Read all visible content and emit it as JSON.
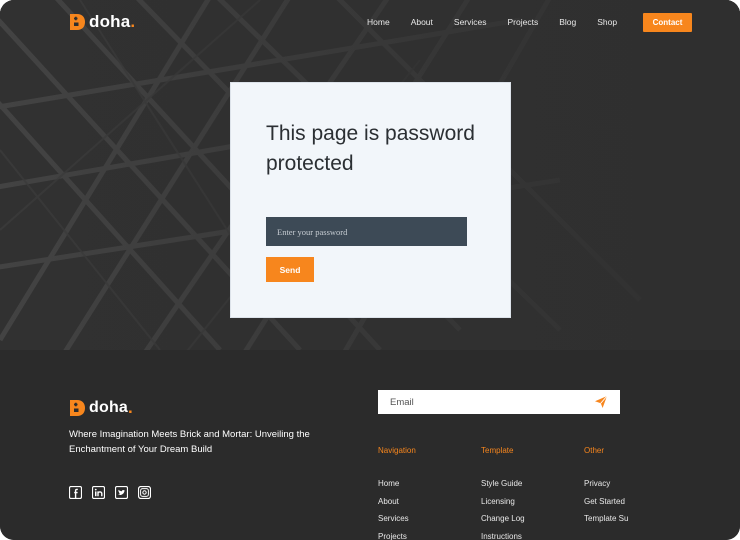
{
  "brand": {
    "name": "doha",
    "dot": ".",
    "accent_color": "#f7861d"
  },
  "header": {
    "nav": [
      "Home",
      "About",
      "Services",
      "Projects",
      "Blog",
      "Shop"
    ],
    "contact_label": "Contact"
  },
  "card": {
    "title": "This page is password protected",
    "password_placeholder": "Enter your password",
    "send_label": "Send"
  },
  "footer": {
    "tagline": "Where Imagination Meets Brick and Mortar: Unveiling the Enchantment of Your Dream Build",
    "email_placeholder": "Email",
    "socials": [
      "facebook-icon",
      "linkedin-icon",
      "twitter-icon",
      "instagram-icon"
    ],
    "columns": [
      {
        "heading": "Navigation",
        "links": [
          "Home",
          "About",
          "Services",
          "Projects"
        ]
      },
      {
        "heading": "Template",
        "links": [
          "Style Guide",
          "Licensing",
          "Change Log",
          "Instructions"
        ]
      },
      {
        "heading": "Other",
        "links": [
          "Privacy",
          "Get Started",
          "Template Su"
        ]
      }
    ]
  }
}
